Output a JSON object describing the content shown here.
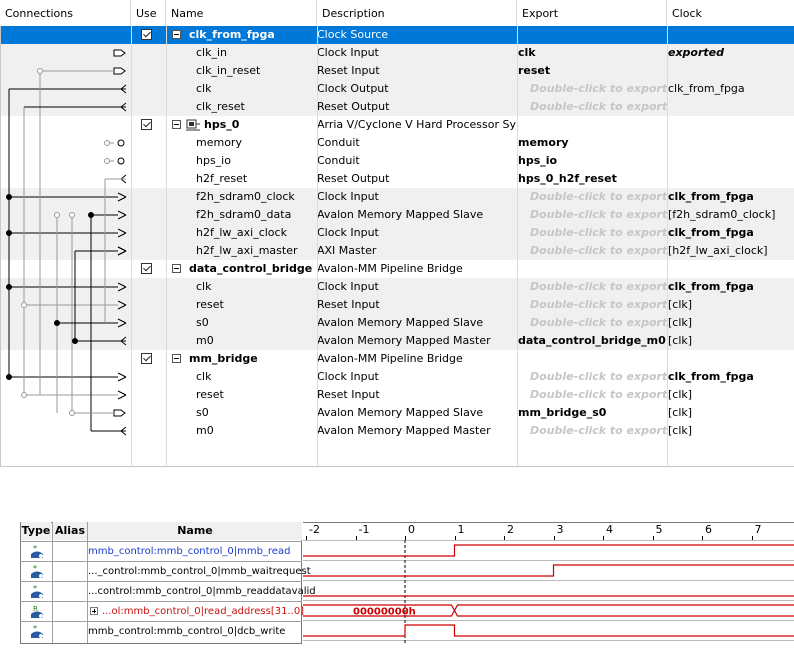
{
  "table": {
    "headers": [
      "Connections",
      "Use",
      "Name",
      "Description",
      "Export",
      "Clock"
    ],
    "placeholder_export": "Double-click to export",
    "rows": [
      {
        "type": "module",
        "checked": true,
        "name": "clk_from_fpga",
        "description": "Clock Source",
        "export": "",
        "clock": "",
        "selected": true
      },
      {
        "type": "port",
        "name": "clk_in",
        "description": "Clock Input",
        "export": "clk",
        "export_style": "bold",
        "clock": "exported",
        "clock_style": "bold-italic"
      },
      {
        "type": "port",
        "name": "clk_in_reset",
        "description": "Reset Input",
        "export": "reset",
        "export_style": "bold",
        "clock": ""
      },
      {
        "type": "port",
        "name": "clk",
        "description": "Clock Output",
        "export": "Double-click to export",
        "export_style": "placeholder",
        "clock": "clk_from_fpga"
      },
      {
        "type": "port",
        "name": "clk_reset",
        "description": "Reset Output",
        "export": "Double-click to export",
        "export_style": "placeholder",
        "clock": ""
      },
      {
        "type": "module",
        "checked": true,
        "name": "hps_0",
        "description": "Arria V/Cyclone V Hard Processor System",
        "export": "",
        "clock": "",
        "icon": "processor-icon"
      },
      {
        "type": "port",
        "name": "memory",
        "description": "Conduit",
        "export": "memory",
        "export_style": "bold",
        "clock": ""
      },
      {
        "type": "port",
        "name": "hps_io",
        "description": "Conduit",
        "export": "hps_io",
        "export_style": "bold",
        "clock": ""
      },
      {
        "type": "port",
        "name": "h2f_reset",
        "description": "Reset Output",
        "export": "hps_0_h2f_reset",
        "export_style": "bold",
        "clock": ""
      },
      {
        "type": "port",
        "name": "f2h_sdram0_clock",
        "description": "Clock Input",
        "export": "Double-click to export",
        "export_style": "placeholder",
        "clock": "clk_from_fpga",
        "clock_style": "bold"
      },
      {
        "type": "port",
        "name": "f2h_sdram0_data",
        "description": "Avalon Memory Mapped Slave",
        "export": "Double-click to export",
        "export_style": "placeholder",
        "clock": "[f2h_sdram0_clock]"
      },
      {
        "type": "port",
        "name": "h2f_lw_axi_clock",
        "description": "Clock Input",
        "export": "Double-click to export",
        "export_style": "placeholder",
        "clock": "clk_from_fpga",
        "clock_style": "bold"
      },
      {
        "type": "port",
        "name": "h2f_lw_axi_master",
        "description": "AXI Master",
        "export": "Double-click to export",
        "export_style": "placeholder",
        "clock": "[h2f_lw_axi_clock]"
      },
      {
        "type": "module",
        "checked": true,
        "name": "data_control_bridge",
        "description": "Avalon-MM Pipeline Bridge",
        "export": "",
        "clock": ""
      },
      {
        "type": "port",
        "name": "clk",
        "description": "Clock Input",
        "export": "Double-click to export",
        "export_style": "placeholder",
        "clock": "clk_from_fpga",
        "clock_style": "bold"
      },
      {
        "type": "port",
        "name": "reset",
        "description": "Reset Input",
        "export": "Double-click to export",
        "export_style": "placeholder",
        "clock": "[clk]"
      },
      {
        "type": "port",
        "name": "s0",
        "description": "Avalon Memory Mapped Slave",
        "export": "Double-click to export",
        "export_style": "placeholder",
        "clock": "[clk]"
      },
      {
        "type": "port",
        "name": "m0",
        "description": "Avalon Memory Mapped Master",
        "export": "data_control_bridge_m0",
        "export_style": "bold",
        "clock": "[clk]"
      },
      {
        "type": "module",
        "checked": true,
        "name": "mm_bridge",
        "description": "Avalon-MM Pipeline Bridge",
        "export": "",
        "clock": ""
      },
      {
        "type": "port",
        "name": "clk",
        "description": "Clock Input",
        "export": "Double-click to export",
        "export_style": "placeholder",
        "clock": "clk_from_fpga",
        "clock_style": "bold"
      },
      {
        "type": "port",
        "name": "reset",
        "description": "Reset Input",
        "export": "Double-click to export",
        "export_style": "placeholder",
        "clock": "[clk]"
      },
      {
        "type": "port",
        "name": "s0",
        "description": "Avalon Memory Mapped Slave",
        "export": "mm_bridge_s0",
        "export_style": "bold",
        "clock": "[clk]"
      },
      {
        "type": "port",
        "name": "m0",
        "description": "Avalon Memory Mapped Master",
        "export": "Double-click to export",
        "export_style": "placeholder",
        "clock": "[clk]"
      }
    ]
  },
  "waveform": {
    "headers": {
      "type": "Type",
      "alias": "Alias",
      "name": "Name"
    },
    "time_ticks": [
      "-2",
      "-1",
      "0",
      "1",
      "2",
      "3",
      "4",
      "5",
      "6",
      "7"
    ],
    "signals": [
      {
        "name": "mmb_control:mmb_control_0|mmb_read",
        "type_icon": "output-pin-icon",
        "name_color": "#1a3ccc",
        "edges": [
          [
            1,
            1
          ]
        ],
        "initial": 0,
        "kind": "bit"
      },
      {
        "name": "..._control:mmb_control_0|mmb_waitrequest",
        "type_icon": "output-pin-icon",
        "name_color": "#000000",
        "edges": [
          [
            3,
            1
          ]
        ],
        "initial": 0,
        "kind": "bit"
      },
      {
        "name": "...control:mmb_control_0|mmb_readdatavalid",
        "type_icon": "output-pin-icon",
        "name_color": "#000000",
        "edges": [],
        "initial": 0,
        "kind": "bit"
      },
      {
        "name": "...ol:mmb_control_0|read_address[31..0]",
        "type_icon": "register-bus-icon",
        "name_color": "#cc1010",
        "kind": "bus",
        "bus_value": "00000000h",
        "transition": 1
      },
      {
        "name": "mmb_control:mmb_control_0|dcb_write",
        "type_icon": "output-pin-icon",
        "name_color": "#000000",
        "edges": [
          [
            0,
            1
          ],
          [
            1,
            0
          ]
        ],
        "initial": 0,
        "kind": "bit"
      }
    ]
  },
  "colors": {
    "selected_row": "#0078d7",
    "wave": "#cc0000",
    "grid": "#dcdcdc",
    "alt_row": "#f0f0f0"
  }
}
